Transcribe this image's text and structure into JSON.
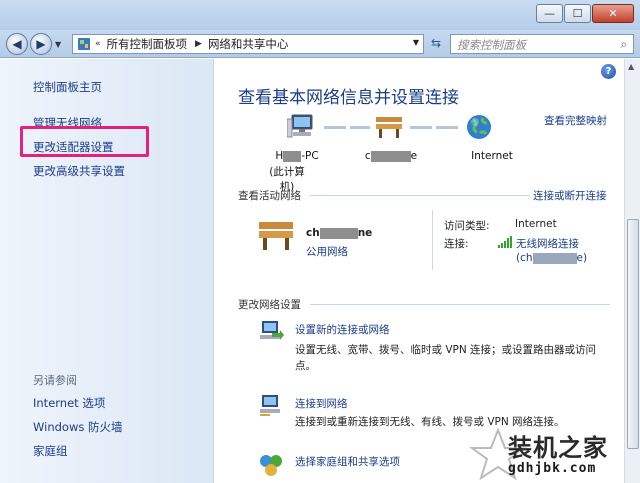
{
  "window": {
    "minimize_glyph": "—",
    "maximize_glyph": "☐",
    "close_glyph": "✕"
  },
  "address": {
    "prefix": "«",
    "crumbs": [
      "所有控制面板项",
      "网络和共享中心"
    ],
    "search_placeholder": "搜索控制面板"
  },
  "sidebar": {
    "home": "控制面板主页",
    "links": [
      "管理无线网络",
      "更改适配器设置",
      "更改高级共享设置"
    ],
    "see_also_title": "另请参阅",
    "see_also": [
      "Internet 选项",
      "Windows 防火墙",
      "家庭组"
    ]
  },
  "main": {
    "title": "查看基本网络信息并设置连接",
    "full_map": "查看完整映射",
    "map": {
      "pc_name_start": "H",
      "pc_name_end": "-PC",
      "pc_sub": "(此计算机)",
      "router_start": "c",
      "router_end": "e",
      "internet": "Internet"
    },
    "active_section": "查看活动网络",
    "connect_disconnect": "连接或断开连接",
    "active": {
      "name_start": "ch",
      "name_end": "ne",
      "type": "公用网络",
      "access_label": "访问类型:",
      "access_value": "Internet",
      "conn_label": "连接:",
      "conn_value": "无线网络连接",
      "conn_sub_start": "(ch",
      "conn_sub_end": "e)"
    },
    "change_section": "更改网络设置",
    "tasks": [
      {
        "title": "设置新的连接或网络",
        "desc": "设置无线、宽带、拨号、临时或 VPN 连接；或设置路由器或访问点。"
      },
      {
        "title": "连接到网络",
        "desc": "连接到或重新连接到无线、有线、拨号或 VPN 网络连接。"
      },
      {
        "title": "选择家庭组和共享选项",
        "desc": ""
      }
    ]
  },
  "watermark": {
    "text": "装机之家",
    "url": "gdhjbk.com"
  }
}
